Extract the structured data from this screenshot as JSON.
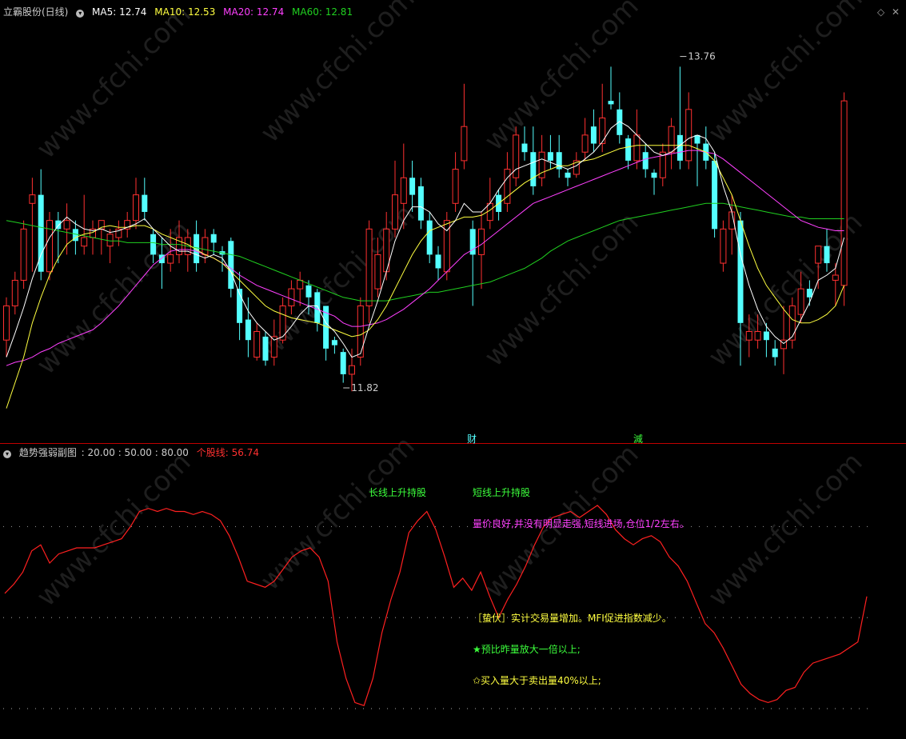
{
  "main_header": {
    "stock_name": "立霸股份(日线)",
    "ma5": "MA5: 12.74",
    "ma10": "MA10: 12.53",
    "ma20": "MA20: 12.74",
    "ma60": "MA60: 12.81"
  },
  "sub_header": {
    "title": "趋势强弱副图",
    "params": ": 20.00  : 50.00  : 80.00",
    "indicator": "个股线: 56.74"
  },
  "colors": {
    "up": "#ff3030",
    "down": "#54ffff",
    "ma5": "#ffffff",
    "ma10": "#ffff40",
    "ma20": "#ff40ff",
    "ma60": "#20d020",
    "strength": "#ff2020",
    "divider": "#c00000"
  },
  "markers": {
    "high_label": "13.76",
    "low_label": "11.82",
    "event1": "财",
    "event2": "減"
  },
  "annotations": {
    "long_up": "长线上升持股",
    "short_up": "短线上升持股",
    "price_note": "量价良好,并没有明显走强,短线进场,仓位1/2左右。",
    "ambush": "［蛰伏］实计交易量增加。MFI促进指数减少。",
    "star1": "★预比昨量放大一倍以上;",
    "star2": "✩买入量大于卖出量40%以上;"
  },
  "chart_data": [
    {
      "type": "candlestick",
      "title": "立霸股份(日线)",
      "ylim": [
        11.6,
        13.95
      ],
      "candles": [
        [
          12.1,
          12.3,
          12.35,
          12.0
        ],
        [
          12.3,
          12.45,
          12.5,
          12.25
        ],
        [
          12.45,
          12.75,
          12.8,
          12.4
        ],
        [
          12.9,
          12.95,
          13.05,
          12.5
        ],
        [
          12.95,
          12.5,
          13.1,
          12.45
        ],
        [
          12.5,
          12.8,
          12.85,
          12.45
        ],
        [
          12.8,
          12.75,
          12.85,
          12.55
        ],
        [
          12.75,
          12.8,
          12.9,
          12.6
        ],
        [
          12.75,
          12.68,
          12.8,
          12.6
        ],
        [
          12.65,
          12.7,
          12.95,
          12.6
        ],
        [
          12.7,
          12.75,
          12.8,
          12.6
        ],
        [
          12.75,
          12.8,
          12.8,
          12.6
        ],
        [
          12.65,
          12.72,
          12.75,
          12.55
        ],
        [
          12.7,
          12.75,
          12.8,
          12.65
        ],
        [
          12.75,
          12.8,
          12.85,
          12.7
        ],
        [
          12.8,
          12.95,
          13.05,
          12.75
        ],
        [
          12.95,
          12.85,
          13.05,
          12.8
        ],
        [
          12.72,
          12.6,
          12.75,
          12.55
        ],
        [
          12.6,
          12.55,
          12.7,
          12.4
        ],
        [
          12.55,
          12.6,
          12.75,
          12.5
        ],
        [
          12.6,
          12.7,
          12.8,
          12.55
        ],
        [
          12.6,
          12.7,
          12.75,
          12.5
        ],
        [
          12.72,
          12.55,
          12.8,
          12.5
        ],
        [
          12.6,
          12.7,
          12.75,
          12.55
        ],
        [
          12.72,
          12.67,
          12.75,
          12.6
        ],
        [
          12.62,
          12.6,
          12.65,
          12.5
        ],
        [
          12.68,
          12.4,
          12.7,
          12.35
        ],
        [
          12.4,
          12.2,
          12.5,
          12.1
        ],
        [
          12.22,
          12.1,
          12.35,
          12.0
        ],
        [
          12.0,
          12.15,
          12.2,
          11.98
        ],
        [
          12.12,
          11.98,
          12.15,
          11.95
        ],
        [
          12.0,
          12.12,
          12.22,
          11.95
        ],
        [
          12.1,
          12.3,
          12.35,
          12.08
        ],
        [
          12.3,
          12.4,
          12.45,
          12.25
        ],
        [
          12.4,
          12.45,
          12.5,
          12.3
        ],
        [
          12.42,
          12.35,
          12.45,
          12.25
        ],
        [
          12.38,
          12.2,
          12.4,
          12.15
        ],
        [
          12.3,
          12.05,
          12.3,
          11.98
        ],
        [
          12.1,
          12.07,
          12.12,
          12.02
        ],
        [
          12.03,
          11.9,
          12.05,
          11.85
        ],
        [
          11.9,
          11.95,
          12.05,
          11.8
        ],
        [
          12.0,
          12.3,
          12.35,
          11.95
        ],
        [
          12.3,
          12.75,
          12.8,
          12.2
        ],
        [
          12.4,
          12.6,
          12.7,
          12.35
        ],
        [
          12.5,
          12.75,
          12.85,
          12.45
        ],
        [
          12.75,
          12.95,
          13.15,
          12.7
        ],
        [
          12.9,
          13.05,
          13.25,
          12.75
        ],
        [
          13.05,
          12.95,
          13.15,
          12.85
        ],
        [
          13.0,
          12.8,
          13.05,
          12.75
        ],
        [
          12.8,
          12.6,
          12.85,
          12.55
        ],
        [
          12.6,
          12.52,
          12.65,
          12.45
        ],
        [
          12.5,
          12.8,
          12.85,
          12.45
        ],
        [
          12.9,
          13.1,
          13.2,
          12.85
        ],
        [
          13.15,
          13.35,
          13.6,
          13.1
        ],
        [
          12.75,
          12.6,
          12.8,
          12.3
        ],
        [
          12.6,
          12.75,
          12.85,
          12.4
        ],
        [
          12.8,
          12.9,
          13.05,
          12.75
        ],
        [
          12.95,
          12.85,
          12.98,
          12.8
        ],
        [
          12.9,
          13.1,
          13.2,
          12.85
        ],
        [
          13.05,
          13.3,
          13.35,
          13.0
        ],
        [
          13.25,
          13.2,
          13.35,
          13.15
        ],
        [
          13.2,
          13.0,
          13.35,
          12.95
        ],
        [
          13.05,
          13.2,
          13.3,
          13.0
        ],
        [
          13.2,
          13.15,
          13.3,
          13.1
        ],
        [
          13.2,
          13.1,
          13.3,
          13.05
        ],
        [
          13.08,
          13.05,
          13.1,
          13.0
        ],
        [
          13.07,
          13.15,
          13.2,
          13.05
        ],
        [
          13.2,
          13.3,
          13.4,
          13.15
        ],
        [
          13.35,
          13.25,
          13.45,
          13.2
        ],
        [
          13.25,
          13.4,
          13.6,
          13.2
        ],
        [
          13.5,
          13.48,
          13.7,
          13.45
        ],
        [
          13.45,
          13.3,
          13.55,
          13.25
        ],
        [
          13.28,
          13.15,
          13.3,
          13.1
        ],
        [
          13.15,
          13.3,
          13.45,
          13.1
        ],
        [
          13.2,
          13.1,
          13.25,
          13.05
        ],
        [
          13.08,
          13.05,
          13.1,
          12.95
        ],
        [
          13.05,
          13.2,
          13.25,
          13.0
        ],
        [
          13.2,
          13.35,
          13.4,
          13.1
        ],
        [
          13.3,
          13.15,
          13.7,
          13.1
        ],
        [
          13.15,
          13.45,
          13.55,
          13.1
        ],
        [
          13.3,
          13.25,
          13.3,
          13.0
        ],
        [
          13.25,
          13.15,
          13.35,
          13.1
        ],
        [
          13.15,
          12.75,
          13.2,
          12.7
        ],
        [
          12.55,
          12.75,
          12.8,
          12.5
        ],
        [
          12.75,
          12.85,
          12.95,
          12.6
        ],
        [
          12.8,
          12.2,
          12.85,
          11.95
        ],
        [
          12.1,
          12.15,
          12.25,
          12.0
        ],
        [
          12.1,
          12.15,
          12.25,
          12.05
        ],
        [
          12.15,
          12.1,
          12.2,
          12.0
        ],
        [
          12.05,
          12.0,
          12.1,
          11.95
        ],
        [
          12.05,
          12.1,
          12.3,
          11.9
        ],
        [
          12.1,
          12.3,
          12.35,
          12.05
        ],
        [
          12.25,
          12.4,
          12.5,
          12.2
        ],
        [
          12.4,
          12.35,
          12.45,
          12.3
        ],
        [
          12.55,
          12.65,
          12.65,
          12.4
        ],
        [
          12.65,
          12.55,
          12.75,
          12.5
        ],
        [
          12.45,
          12.48,
          12.55,
          12.3
        ],
        [
          12.42,
          13.5,
          13.55,
          12.3
        ]
      ],
      "ma5": [
        12.0,
        12.14,
        12.29,
        12.46,
        12.6,
        12.7,
        12.77,
        12.82,
        12.78,
        12.75,
        12.74,
        12.75,
        12.73,
        12.74,
        12.76,
        12.78,
        12.81,
        12.75,
        12.7,
        12.65,
        12.62,
        12.62,
        12.6,
        12.58,
        12.6,
        12.58,
        12.5,
        12.37,
        12.27,
        12.2,
        12.15,
        12.1,
        12.12,
        12.18,
        12.25,
        12.3,
        12.3,
        12.2,
        12.15,
        12.08,
        12.0,
        12.02,
        12.18,
        12.33,
        12.5,
        12.68,
        12.8,
        12.88,
        12.88,
        12.85,
        12.78,
        12.74,
        12.8,
        12.9,
        12.85,
        12.85,
        12.9,
        12.98,
        13.05,
        13.1,
        13.12,
        13.14,
        13.16,
        13.14,
        13.12,
        13.1,
        13.12,
        13.16,
        13.2,
        13.26,
        13.34,
        13.38,
        13.35,
        13.3,
        13.25,
        13.2,
        13.18,
        13.2,
        13.24,
        13.28,
        13.3,
        13.28,
        13.2,
        13.0,
        12.85,
        12.6,
        12.42,
        12.28,
        12.18,
        12.12,
        12.08,
        12.12,
        12.22,
        12.32,
        12.45,
        12.48,
        12.52,
        12.7
      ],
      "ma10": [
        11.7,
        11.85,
        12.0,
        12.2,
        12.35,
        12.48,
        12.58,
        12.66,
        12.7,
        12.72,
        12.73,
        12.76,
        12.77,
        12.76,
        12.76,
        12.77,
        12.77,
        12.75,
        12.72,
        12.7,
        12.68,
        12.66,
        12.63,
        12.6,
        12.58,
        12.55,
        12.5,
        12.45,
        12.4,
        12.35,
        12.3,
        12.27,
        12.25,
        12.23,
        12.22,
        12.21,
        12.2,
        12.18,
        12.16,
        12.14,
        12.12,
        12.13,
        12.16,
        12.22,
        12.3,
        12.4,
        12.5,
        12.6,
        12.68,
        12.74,
        12.76,
        12.78,
        12.8,
        12.82,
        12.82,
        12.83,
        12.86,
        12.9,
        12.94,
        12.98,
        13.02,
        13.05,
        13.08,
        13.1,
        13.12,
        13.12,
        13.14,
        13.15,
        13.16,
        13.18,
        13.2,
        13.22,
        13.23,
        13.24,
        13.24,
        13.24,
        13.24,
        13.24,
        13.24,
        13.24,
        13.22,
        13.2,
        13.15,
        13.05,
        12.95,
        12.8,
        12.65,
        12.52,
        12.42,
        12.35,
        12.28,
        12.22,
        12.2,
        12.2,
        12.22,
        12.25,
        12.3,
        12.42
      ],
      "ma20": [
        11.95,
        11.97,
        11.98,
        12.0,
        12.03,
        12.05,
        12.08,
        12.1,
        12.12,
        12.14,
        12.16,
        12.2,
        12.25,
        12.3,
        12.36,
        12.42,
        12.48,
        12.54,
        12.58,
        12.62,
        12.63,
        12.63,
        12.62,
        12.6,
        12.58,
        12.55,
        12.52,
        12.48,
        12.45,
        12.42,
        12.4,
        12.38,
        12.36,
        12.34,
        12.32,
        12.3,
        12.28,
        12.26,
        12.24,
        12.2,
        12.18,
        12.18,
        12.19,
        12.2,
        12.22,
        12.25,
        12.28,
        12.32,
        12.36,
        12.4,
        12.45,
        12.5,
        12.55,
        12.6,
        12.63,
        12.66,
        12.7,
        12.74,
        12.78,
        12.82,
        12.86,
        12.9,
        12.92,
        12.94,
        12.96,
        12.98,
        13.0,
        13.02,
        13.04,
        13.06,
        13.08,
        13.1,
        13.12,
        13.14,
        13.16,
        13.17,
        13.18,
        13.19,
        13.2,
        13.21,
        13.21,
        13.2,
        13.19,
        13.16,
        13.12,
        13.08,
        13.04,
        13.0,
        12.96,
        12.92,
        12.88,
        12.84,
        12.8,
        12.78,
        12.76,
        12.75,
        12.74,
        12.74
      ],
      "ma60": [
        12.8,
        12.79,
        12.78,
        12.77,
        12.76,
        12.75,
        12.74,
        12.73,
        12.72,
        12.71,
        12.7,
        12.69,
        12.68,
        12.68,
        12.67,
        12.67,
        12.67,
        12.67,
        12.66,
        12.66,
        12.66,
        12.65,
        12.64,
        12.63,
        12.62,
        12.61,
        12.6,
        12.59,
        12.57,
        12.55,
        12.53,
        12.51,
        12.49,
        12.47,
        12.45,
        12.43,
        12.41,
        12.39,
        12.37,
        12.35,
        12.34,
        12.33,
        12.33,
        12.33,
        12.33,
        12.34,
        12.35,
        12.36,
        12.37,
        12.38,
        12.38,
        12.39,
        12.4,
        12.41,
        12.42,
        12.43,
        12.44,
        12.46,
        12.48,
        12.5,
        12.52,
        12.55,
        12.58,
        12.62,
        12.65,
        12.68,
        12.7,
        12.72,
        12.74,
        12.76,
        12.78,
        12.8,
        12.81,
        12.82,
        12.83,
        12.84,
        12.85,
        12.86,
        12.87,
        12.88,
        12.89,
        12.9,
        12.9,
        12.9,
        12.89,
        12.88,
        12.87,
        12.86,
        12.85,
        12.84,
        12.83,
        12.82,
        12.82,
        12.81,
        12.81,
        12.81,
        12.81,
        12.81
      ],
      "high": {
        "value": 13.76,
        "index": 78
      },
      "low": {
        "value": 11.82,
        "index": 39
      }
    },
    {
      "type": "line",
      "title": "趋势强弱副图",
      "ylim": [
        15,
        102
      ],
      "reference_lines": [
        20,
        50,
        80
      ],
      "series": [
        {
          "name": "个股线",
          "values": [
            58,
            61,
            65,
            72,
            74,
            68,
            71,
            72,
            73,
            73,
            73,
            74,
            75,
            76,
            80,
            85,
            86,
            85,
            86,
            85,
            85,
            84,
            85,
            84,
            82,
            77,
            70,
            62,
            61,
            60,
            62,
            66,
            70,
            72,
            73,
            70,
            62,
            42,
            30,
            22,
            21,
            30,
            45,
            56,
            65,
            78,
            82,
            85,
            79,
            70,
            60,
            63,
            59,
            65,
            57,
            50,
            56,
            61,
            67,
            74,
            80,
            83,
            84,
            85,
            83,
            85,
            87,
            84,
            79,
            76,
            74,
            76,
            77,
            75,
            70,
            67,
            62,
            55,
            48,
            45,
            40,
            34,
            28,
            25,
            23,
            22,
            23,
            26,
            27,
            32,
            35,
            36,
            37,
            38,
            40,
            42,
            57
          ]
        }
      ]
    }
  ]
}
